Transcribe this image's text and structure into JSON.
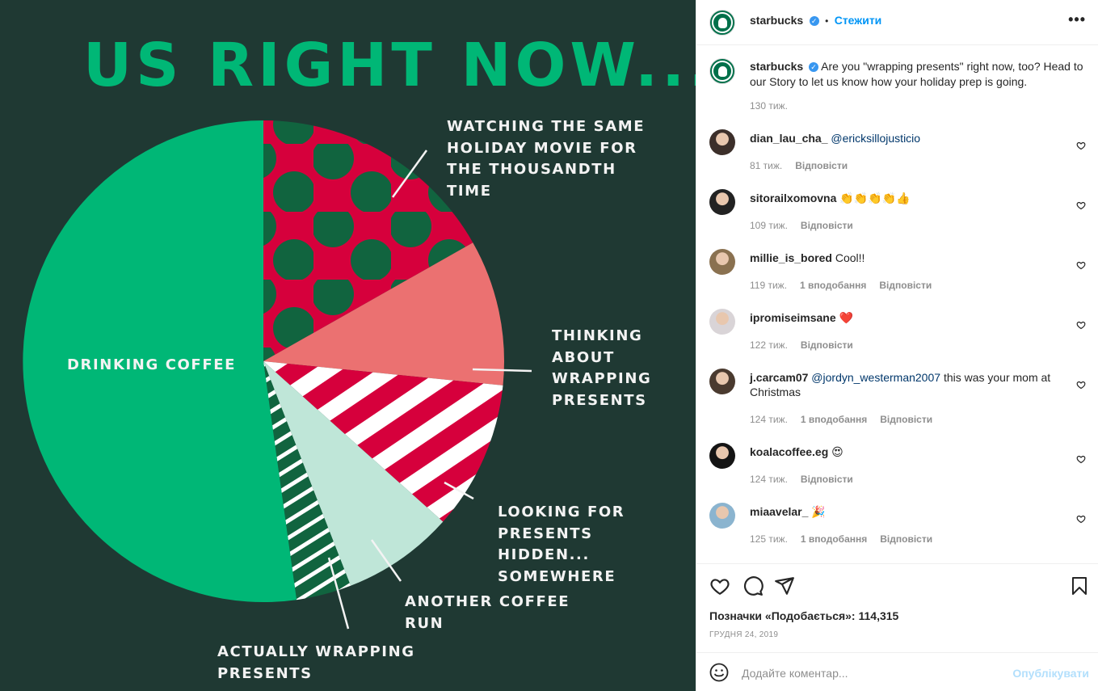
{
  "post_image": {
    "title": "US RIGHT NOW...",
    "colors": {
      "background": "#1f3933",
      "coffee": "#00b776",
      "movie": "#d6003c",
      "thinking": "#eb7171",
      "looking": "#d6003c",
      "another": "#bfe6d8",
      "actually": "#11643f"
    },
    "chart_data": {
      "type": "pie",
      "title": "US RIGHT NOW...",
      "slices": [
        {
          "label": "WATCHING THE SAME HOLIDAY MOVIE FOR THE THOUSANDTH TIME",
          "value": 16.8,
          "pattern": "polka-dots"
        },
        {
          "label": "THINKING ABOUT WRAPPING PRESENTS",
          "value": 9.8,
          "pattern": "solid"
        },
        {
          "label": "LOOKING FOR PRESENTS HIDDEN... SOMEWHERE",
          "value": 10.0,
          "pattern": "stripes"
        },
        {
          "label": "ANOTHER COFFEE RUN",
          "value": 7.5,
          "pattern": "solid"
        },
        {
          "label": "ACTUALLY WRAPPING PRESENTS",
          "value": 3.7,
          "pattern": "stripes"
        },
        {
          "label": "DRINKING COFFEE",
          "value": 52.2,
          "pattern": "solid"
        }
      ]
    }
  },
  "header": {
    "username": "starbucks",
    "verified_mark": "✓",
    "separator": "•",
    "follow_label": "Стежити",
    "menu_label": "•••"
  },
  "caption": {
    "username": "starbucks",
    "text": "Are you \"wrapping presents\" right now, too? Head to our Story to let us know how your holiday prep is going.",
    "time": "130 тиж."
  },
  "comments": [
    {
      "username": "dian_lau_cha_",
      "mention": "@ericksillojusticio",
      "text": "",
      "time": "81 тиж.",
      "likes": "",
      "reply": "Відповісти",
      "avatar_color": "#3c2f2a"
    },
    {
      "username": "sitorailxomovna",
      "mention": "",
      "text": "👏👏👏👏👍",
      "time": "109 тиж.",
      "likes": "",
      "reply": "Відповісти",
      "avatar_color": "#222222"
    },
    {
      "username": "millie_is_bored",
      "mention": "",
      "text": "Cool!!",
      "time": "119 тиж.",
      "likes": "1 вподобання",
      "reply": "Відповісти",
      "avatar_color": "#8a7150"
    },
    {
      "username": "ipromiseimsane",
      "mention": "",
      "text": "❤️",
      "time": "122 тиж.",
      "likes": "",
      "reply": "Відповісти",
      "avatar_color": "#d9d4d7"
    },
    {
      "username": "j.carcam07",
      "mention": "@jordyn_westerman2007",
      "text": "this was your mom at Christmas",
      "time": "124 тиж.",
      "likes": "1 вподобання",
      "reply": "Відповісти",
      "avatar_color": "#4a3a2f"
    },
    {
      "username": "koalacoffee.eg",
      "mention": "",
      "text": "😍",
      "time": "124 тиж.",
      "likes": "",
      "reply": "Відповісти",
      "avatar_color": "#141414"
    },
    {
      "username": "miaavelar_",
      "mention": "",
      "text": "🎉",
      "time": "125 тиж.",
      "likes": "1 вподобання",
      "reply": "Відповісти",
      "avatar_color": "#8bb4cf"
    }
  ],
  "actions": {
    "like_icon": "heart-outline-icon",
    "comment_icon": "comment-bubble-icon",
    "share_icon": "paper-plane-icon",
    "save_icon": "bookmark-icon",
    "likes_text": "Позначки «Подобається»: 114,315",
    "date": "ГРУДНЯ 24, 2019"
  },
  "comment_input": {
    "emoji_icon": "smiley-icon",
    "placeholder": "Додайте коментар...",
    "post_label": "Опублікувати"
  }
}
